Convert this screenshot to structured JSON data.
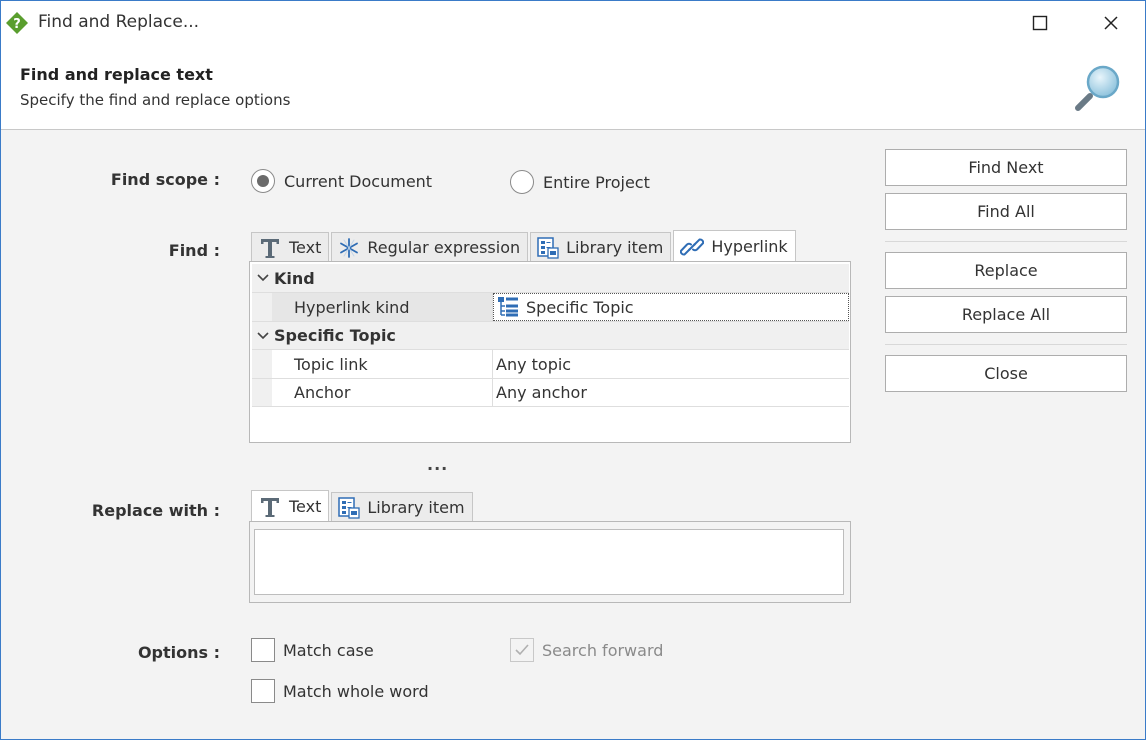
{
  "window": {
    "title": "Find and Replace..."
  },
  "header": {
    "title": "Find and replace text",
    "subtitle": "Specify the find and replace options"
  },
  "find_scope": {
    "label": "Find scope :",
    "options": [
      {
        "label": "Current Document",
        "selected": true
      },
      {
        "label": "Entire Project",
        "selected": false
      }
    ]
  },
  "find": {
    "label": "Find :",
    "tabs": [
      {
        "label": "Text",
        "icon": "text-T-icon",
        "active": false
      },
      {
        "label": "Regular expression",
        "icon": "regex-asterisk-icon",
        "active": false
      },
      {
        "label": "Library item",
        "icon": "library-icon",
        "active": false
      },
      {
        "label": "Hyperlink",
        "icon": "chain-link-icon",
        "active": true
      }
    ],
    "grid": {
      "kind_category": "Kind",
      "hyperlink_kind": {
        "name": "Hyperlink kind",
        "value": "Specific Topic"
      },
      "topic_category": "Specific Topic",
      "topic_link": {
        "name": "Topic link",
        "value": "Any topic"
      },
      "anchor": {
        "name": "Anchor",
        "value": "Any anchor"
      }
    }
  },
  "splitter_text": "...",
  "replace": {
    "label": "Replace with :",
    "tabs": [
      {
        "label": "Text",
        "icon": "text-T-icon",
        "active": true
      },
      {
        "label": "Library item",
        "icon": "library-icon",
        "active": false
      }
    ],
    "value": ""
  },
  "options": {
    "label": "Options :",
    "match_case": {
      "label": "Match case",
      "checked": false
    },
    "match_whole_word": {
      "label": "Match whole word",
      "checked": false
    },
    "search_forward": {
      "label": "Search forward",
      "checked": true,
      "enabled": false
    }
  },
  "buttons": {
    "find_next": "Find Next",
    "find_all": "Find All",
    "replace": "Replace",
    "replace_all": "Replace All",
    "close": "Close"
  },
  "colors": {
    "accent_blue": "#3a7bc8",
    "icon_green": "#5a9e2e",
    "icon_blue": "#2f6db5"
  }
}
